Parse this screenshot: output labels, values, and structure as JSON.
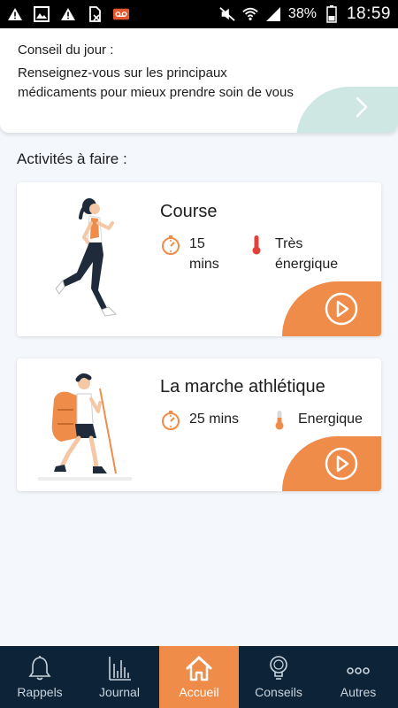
{
  "status_bar": {
    "battery": "38%",
    "time": "18:59",
    "icons": [
      "warning-icon",
      "image-icon",
      "warning-icon",
      "sim-off-icon",
      "voicemail-icon",
      "mute-icon",
      "wifi-icon",
      "signal-icon",
      "battery-icon"
    ]
  },
  "tip": {
    "title": "Conseil du jour :",
    "text": "Renseignez-vous sur les principaux médicaments pour mieux prendre soin de vous"
  },
  "section_title": "Activités à faire :",
  "activities": [
    {
      "name": "Course",
      "duration": "15 mins",
      "intensity": "Très énergique"
    },
    {
      "name": "La marche athlétique",
      "duration": "25 mins",
      "intensity": "Energique"
    }
  ],
  "nav": [
    {
      "label": "Rappels",
      "icon": "bell-icon"
    },
    {
      "label": "Journal",
      "icon": "chart-icon"
    },
    {
      "label": "Accueil",
      "icon": "home-icon",
      "active": true
    },
    {
      "label": "Conseils",
      "icon": "lightbulb-icon"
    },
    {
      "label": "Autres",
      "icon": "more-icon"
    }
  ],
  "colors": {
    "accent": "#f08c4a",
    "nav_bg": "#0d2438",
    "tip_accent": "#cfe7e3",
    "thermo_high": "#e2413a",
    "thermo_mid": "#f08c4a"
  }
}
